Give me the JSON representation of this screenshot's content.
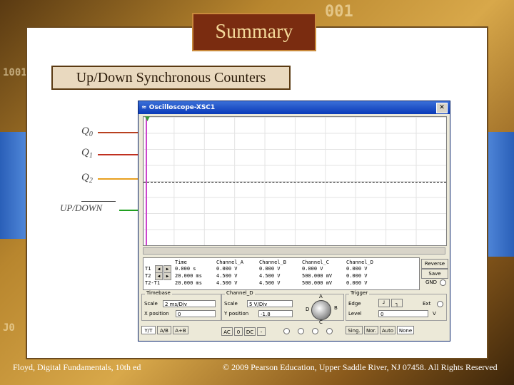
{
  "slide": {
    "title": "Summary",
    "subtitle": "Up/Down Synchronous Counters",
    "signals": [
      {
        "label": "Q",
        "sub": "0",
        "color": "#b84020"
      },
      {
        "label": "Q",
        "sub": "1",
        "color": "#c03020"
      },
      {
        "label": "Q",
        "sub": "2",
        "color": "#e8a020"
      },
      {
        "label": "UP/DOWN",
        "sub": "",
        "color": "#20a020"
      }
    ],
    "footer_left": "Floyd, Digital Fundamentals, 10th ed",
    "footer_right": "© 2009 Pearson Education, Upper Saddle River, NJ 07458. All Rights Reserved"
  },
  "background": {
    "numbers": [
      "1001",
      "001",
      "J0"
    ]
  },
  "scope": {
    "title": "Oscilloscope-XSC1",
    "close": "✕",
    "readout": {
      "headers": [
        "Time",
        "Channel_A",
        "Channel_B",
        "Channel_C",
        "Channel_D"
      ],
      "rows": [
        {
          "label": "T1",
          "values": [
            "0.000 s",
            "0.000 V",
            "0.000 V",
            "0.000 V",
            "0.000 V"
          ]
        },
        {
          "label": "T2",
          "values": [
            "20.000 ms",
            "4.500 V",
            "4.500 V",
            "500.000 mV",
            "0.000 V"
          ]
        },
        {
          "label": "T2-T1",
          "values": [
            "20.000 ms",
            "4.500 V",
            "4.500 V",
            "500.000 mV",
            "0.000 V"
          ]
        }
      ]
    },
    "side_buttons": [
      "Reverse",
      "Save"
    ],
    "gnd_label": "GND",
    "timebase": {
      "title": "Timebase",
      "scale_label": "Scale",
      "scale_value": "2 ms/Div",
      "xpos_label": "X position",
      "xpos_value": "0",
      "modes": [
        "Y/T",
        "A/B",
        "A+B"
      ]
    },
    "channel": {
      "title": "Channel_D",
      "scale_label": "Scale",
      "scale_value": "5 V/Div",
      "ypos_label": "Y position",
      "ypos_value": "-1.8",
      "coupling": [
        "AC",
        "0",
        "DC",
        "-"
      ],
      "knob_labels": [
        "A",
        "B",
        "C",
        "D"
      ]
    },
    "trigger": {
      "title": "Trigger",
      "edge_label": "Edge",
      "level_label": "Level",
      "level_value": "0",
      "level_unit": "V",
      "ext_label": "Ext",
      "modes": [
        "Sing.",
        "Nor.",
        "Auto",
        "None"
      ]
    }
  }
}
